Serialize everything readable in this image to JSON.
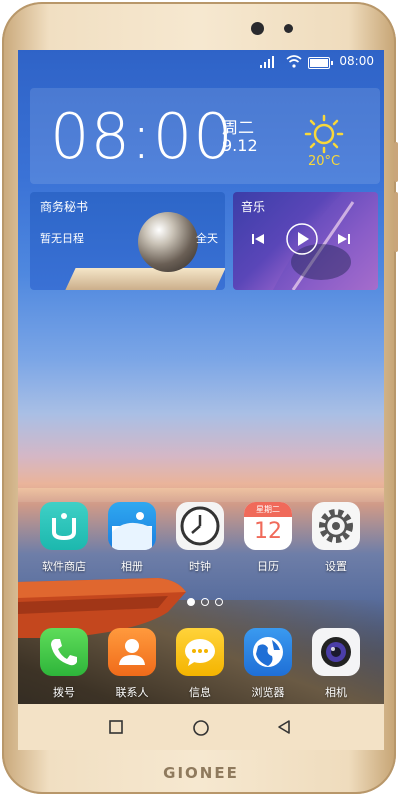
{
  "status": {
    "time": "08:00"
  },
  "clock_widget": {
    "time": "08:00",
    "weekday": "周二",
    "date": "9.12",
    "temperature": "20°C"
  },
  "memo_widget": {
    "title": "商务秘书",
    "subtitle": "暂无日程",
    "all_day": "全天"
  },
  "music_widget": {
    "title": "音乐"
  },
  "page_indicator": {
    "count": 3,
    "active": 0
  },
  "apps_row1": [
    {
      "label": "软件商店",
      "icon": "app-store-icon"
    },
    {
      "label": "相册",
      "icon": "gallery-icon"
    },
    {
      "label": "时钟",
      "icon": "clock-icon"
    },
    {
      "label": "日历",
      "icon": "calendar-icon",
      "cal_weekday": "星期二",
      "cal_day": "12"
    },
    {
      "label": "设置",
      "icon": "settings-icon"
    }
  ],
  "dock": [
    {
      "label": "拨号",
      "icon": "phone-icon"
    },
    {
      "label": "联系人",
      "icon": "contacts-icon"
    },
    {
      "label": "信息",
      "icon": "messages-icon"
    },
    {
      "label": "浏览器",
      "icon": "browser-icon"
    },
    {
      "label": "相机",
      "icon": "camera-icon"
    }
  ],
  "brand": "GIONEE",
  "colors": {
    "frame": "#f1dfc2",
    "accent_temp": "#f8d83a",
    "navbar": "#f3e2c6"
  }
}
